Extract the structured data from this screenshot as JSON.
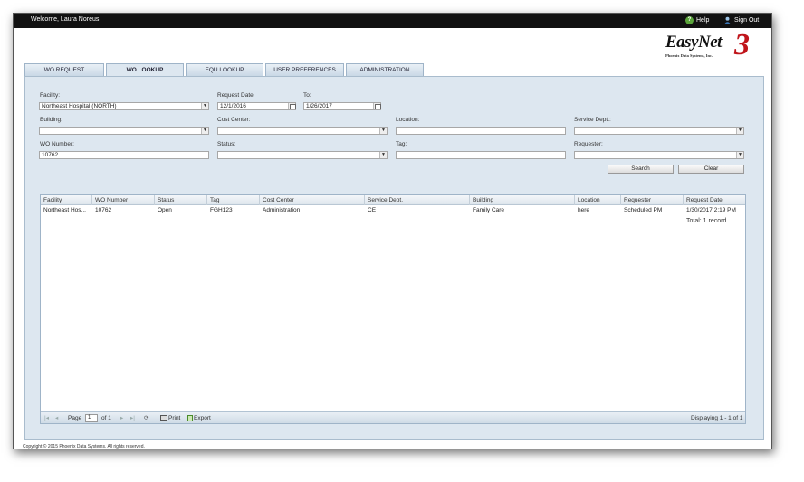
{
  "topbar": {
    "welcome": "Welcome, Laura Noreus",
    "help": "Help",
    "signout": "Sign Out"
  },
  "logo": {
    "name": "EasyNet",
    "number": "3",
    "company": "Phoenix Data Systems, Inc."
  },
  "tabs": [
    {
      "label": "WO REQUEST",
      "active": false
    },
    {
      "label": "WO LOOKUP",
      "active": true
    },
    {
      "label": "EQU LOOKUP",
      "active": false
    },
    {
      "label": "USER PREFERENCES",
      "active": false
    },
    {
      "label": "ADMINISTRATION",
      "active": false
    }
  ],
  "form": {
    "facility_label": "Facility:",
    "facility_value": "Northeast Hospital (NORTH)",
    "request_date_label": "Request Date:",
    "request_date_value": "12/1/2016",
    "to_label": "To:",
    "to_value": "1/26/2017",
    "building_label": "Building:",
    "building_value": "",
    "cost_center_label": "Cost Center:",
    "cost_center_value": "",
    "location_label": "Location:",
    "location_value": "",
    "service_dept_label": "Service Dept.:",
    "service_dept_value": "",
    "wo_number_label": "WO Number:",
    "wo_number_value": "10762",
    "status_label": "Status:",
    "status_value": "",
    "tag_label": "Tag:",
    "tag_value": "",
    "requester_label": "Requester:",
    "requester_value": "",
    "search": "Search",
    "clear": "Clear"
  },
  "grid": {
    "columns": [
      "Facility",
      "WO Number",
      "Status",
      "Tag",
      "Cost Center",
      "Service Dept.",
      "Building",
      "Location",
      "Requester",
      "Request Date"
    ],
    "rows": [
      [
        "Northeast Hos...",
        "10762",
        "Open",
        "FGH123",
        "Administration",
        "CE",
        "Family Care",
        "here",
        "Scheduled PM",
        "1/30/2017 2:19 PM"
      ]
    ],
    "total": "Total: 1 record",
    "footer": {
      "page_label": "Page",
      "page_value": "1",
      "of_label": "of 1",
      "print": "Print",
      "export": "Export",
      "displaying": "Displaying 1 - 1 of 1"
    }
  },
  "copyright": "Copyright © 2015 Phoenix Data Systems. All rights reserved."
}
